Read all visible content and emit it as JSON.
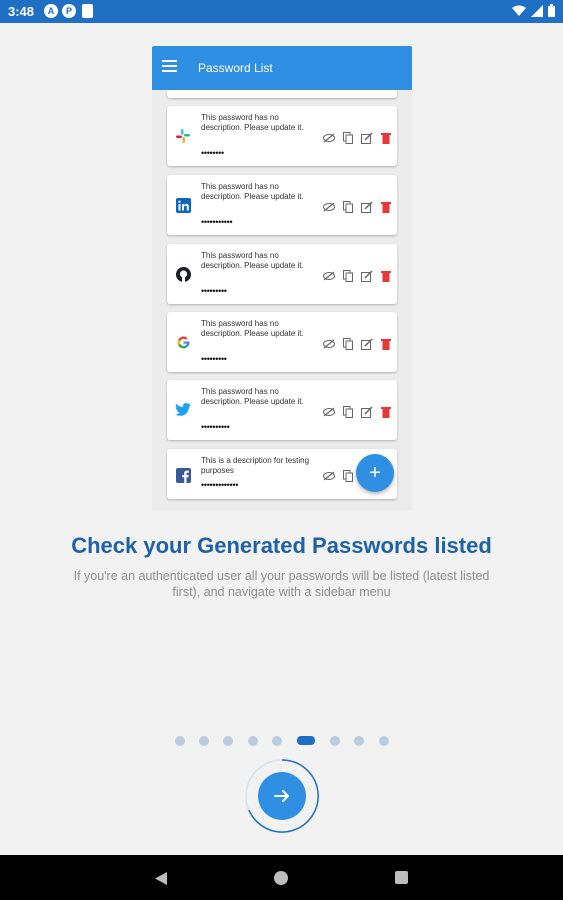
{
  "status_bar": {
    "time": "3:48",
    "badges": [
      "A",
      "P"
    ]
  },
  "mockup": {
    "appbar_title": "Password List",
    "cards": [
      {
        "logo": "slack-icon",
        "description": "This password has no description. Please update it.",
        "password": "••••••••"
      },
      {
        "logo": "linkedin-icon",
        "description": "This password has no description. Please update it.",
        "password": "•••••••••••"
      },
      {
        "logo": "github-icon",
        "description": "This password has no description. Please update it.",
        "password": "•••••••••"
      },
      {
        "logo": "google-icon",
        "description": "This password has no description. Please update it.",
        "password": "•••••••••"
      },
      {
        "logo": "twitter-icon",
        "description": "This password has no description. Please update it.",
        "password": "••••••••••"
      },
      {
        "logo": "facebook-icon",
        "description": "This is a description for testing purposes",
        "password": "•••••••••••••"
      }
    ],
    "fab_label": "+"
  },
  "onboarding": {
    "title": "Check your Generated Passwords listed",
    "subtitle": "If you're an authenticated user all your passwords will be listed (latest listed first), and navigate with a sidebar menu"
  },
  "pager": {
    "page_count": 9,
    "active_index": 5
  },
  "colors": {
    "primary": "#2f8fe2",
    "status_bar": "#1f6fc4",
    "heading": "#1d62a8",
    "delete": "#e53935"
  }
}
